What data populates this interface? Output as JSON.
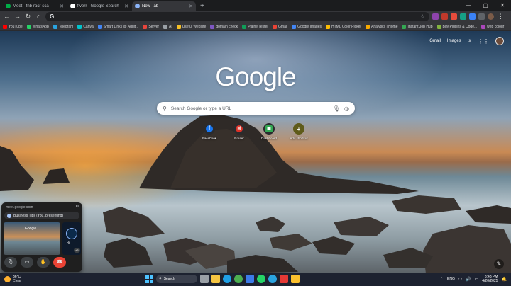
{
  "tabs": [
    {
      "title": "Meet - fnb-racr-sca",
      "icon": "meet-icon",
      "color": "#00ac47",
      "active": false
    },
    {
      "title": "fiverr - Google Search",
      "icon": "google-icon",
      "color": "#ffffff",
      "active": false
    },
    {
      "title": "New Tab",
      "icon": "chrome-icon",
      "color": "#8ab4f8",
      "active": true
    }
  ],
  "toolbar": {
    "omnibox_prefix": "G",
    "omnibox_value": ""
  },
  "bookmarks": [
    {
      "label": "YouTube",
      "color": "#ff0000"
    },
    {
      "label": "WhatsApp",
      "color": "#25d366"
    },
    {
      "label": "Telegram",
      "color": "#2aa3df"
    },
    {
      "label": "Canva",
      "color": "#00c4cc"
    },
    {
      "label": "Smart Links @ Addit...",
      "color": "#4285f4"
    },
    {
      "label": "Server",
      "color": "#e8453c"
    },
    {
      "label": "AI",
      "color": "#9aa0a6"
    },
    {
      "label": "Useful Website",
      "color": "#f6c026"
    },
    {
      "label": "domain check",
      "color": "#7e57c2"
    },
    {
      "label": "Plaine Tester",
      "color": "#0f9d58"
    },
    {
      "label": "Gmail",
      "color": "#ea4335"
    },
    {
      "label": "Google Images",
      "color": "#4285f4"
    },
    {
      "label": "HTML Color Picker",
      "color": "#fbbc04"
    },
    {
      "label": "Analytics | Home",
      "color": "#f9ab00"
    },
    {
      "label": "Instant Job Hub",
      "color": "#34a853"
    },
    {
      "label": "Buy Plugins & Code...",
      "color": "#82b440"
    },
    {
      "label": "web colour",
      "color": "#ab47bc"
    }
  ],
  "newtab": {
    "links": {
      "gmail": "Gmail",
      "images": "Images"
    },
    "logo": "Google",
    "search_placeholder": "Search Google or type a URL",
    "shortcuts": [
      {
        "label": "Facebook",
        "glyph": "f",
        "color": "#1877f2"
      },
      {
        "label": "Router",
        "glyph": "M",
        "color": "#d93025"
      },
      {
        "label": "Dashboard",
        "glyph": "▣",
        "color": "#34a853"
      },
      {
        "label": "Add shortcut",
        "glyph": "+",
        "color": "#5f5b1a"
      }
    ]
  },
  "meet": {
    "url": "meet.google.com",
    "presenting": "Business Tips (You, presenting)",
    "screen_logo": "Google",
    "self_name": "dil",
    "others_count": "+3"
  },
  "taskbar": {
    "temp": "36°C",
    "condition": "Clear",
    "search_label": "Search",
    "time": "8:43 PM",
    "date": "4/20/2025",
    "lang": "ENG"
  }
}
